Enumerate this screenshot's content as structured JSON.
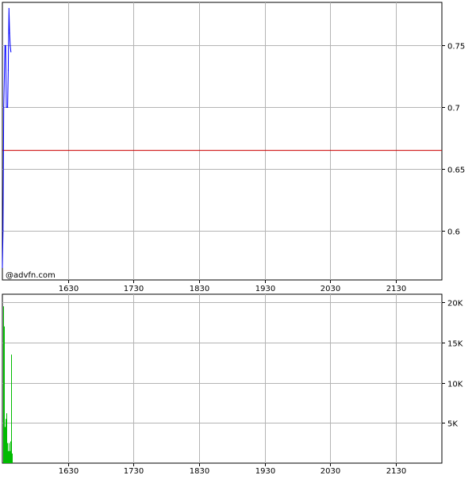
{
  "watermark": "@advfn.com",
  "colors": {
    "price": "#0000ff",
    "reference": "#cc0000",
    "volume": "#00bb00",
    "grid": "#b4b4b4"
  },
  "chart_data": [
    {
      "type": "line",
      "panel": "price",
      "x_ticks": [
        "1630",
        "1730",
        "1830",
        "1930",
        "2030",
        "2130"
      ],
      "x_range": [
        1530,
        2200
      ],
      "y_ticks": [
        0.6,
        0.65,
        0.7,
        0.75
      ],
      "y_tick_labels": [
        "0.6",
        "0.65",
        "0.7",
        "0.75"
      ],
      "ylim": [
        0.56,
        0.785
      ],
      "grid": true,
      "series": [
        {
          "x": [
            1530,
            1531,
            1532,
            1534,
            1535,
            1536,
            1538,
            1539,
            1540,
            1541,
            1542,
            1543
          ],
          "values": [
            0.57,
            0.6,
            0.7,
            0.75,
            0.75,
            0.7,
            0.7,
            0.73,
            0.78,
            0.76,
            0.75,
            0.745
          ]
        }
      ],
      "reference_line": 0.665
    },
    {
      "type": "bar",
      "panel": "volume",
      "x_ticks": [
        "1630",
        "1730",
        "1830",
        "1930",
        "2030",
        "2130"
      ],
      "x_range": [
        1530,
        2200
      ],
      "y_ticks": [
        5000,
        10000,
        15000,
        20000
      ],
      "y_tick_labels": [
        "5K",
        "10K",
        "15K",
        "20K"
      ],
      "ylim": [
        0,
        21000
      ],
      "grid": true,
      "series": [
        {
          "x": [
            1531,
            1533,
            1534,
            1535,
            1536,
            1537,
            1538,
            1540,
            1541,
            1542,
            1543,
            1544,
            1545
          ],
          "values": [
            19500,
            17000,
            4500,
            5500,
            6200,
            2500,
            1500,
            2500,
            1500,
            2700,
            13500,
            1200,
            1000
          ]
        }
      ]
    }
  ]
}
